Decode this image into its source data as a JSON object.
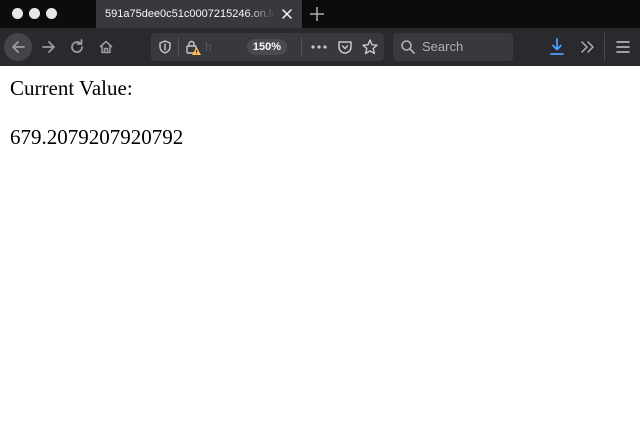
{
  "browser": {
    "tab": {
      "title": "591a75dee0c51c0007215246.on.lo"
    },
    "urlbar": {
      "url_partial": "h",
      "zoom": "150%"
    },
    "search": {
      "placeholder": "Search"
    }
  },
  "page": {
    "label": "Current Value:",
    "value": "679.2079207920792"
  }
}
